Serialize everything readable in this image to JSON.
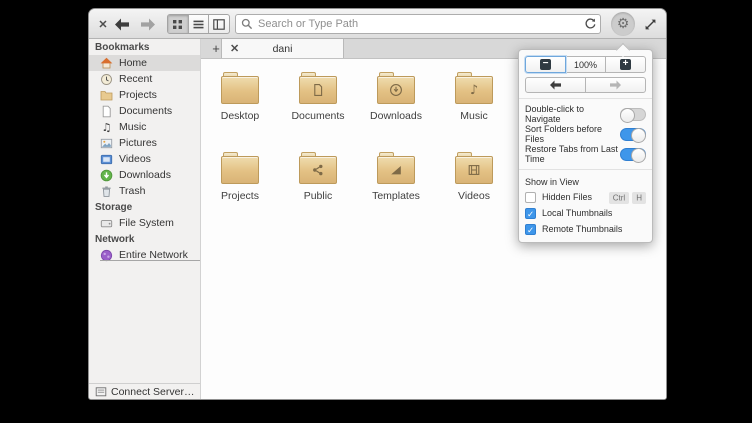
{
  "toolbar": {
    "close_glyph": "✕",
    "search_placeholder": "Search or Type Path"
  },
  "tabbar": {
    "new_tab_glyph": "+",
    "tab_close_glyph": "✕",
    "tab_title": "dani"
  },
  "sidebar": {
    "sections": [
      {
        "header": "Bookmarks",
        "items": [
          {
            "label": "Home"
          },
          {
            "label": "Recent"
          },
          {
            "label": "Projects"
          },
          {
            "label": "Documents"
          },
          {
            "label": "Music"
          },
          {
            "label": "Pictures"
          },
          {
            "label": "Videos"
          },
          {
            "label": "Downloads"
          },
          {
            "label": "Trash"
          }
        ]
      },
      {
        "header": "Storage",
        "items": [
          {
            "label": "File System"
          }
        ]
      },
      {
        "header": "Network",
        "items": [
          {
            "label": "Entire Network"
          }
        ]
      }
    ],
    "connect_server_label": "Connect Server…"
  },
  "files": [
    {
      "name": "Desktop"
    },
    {
      "name": "Documents"
    },
    {
      "name": "Downloads"
    },
    {
      "name": "Music"
    },
    {
      "name": "Projects"
    },
    {
      "name": "Public"
    },
    {
      "name": "Templates"
    },
    {
      "name": "Videos"
    }
  ],
  "popover": {
    "zoom_out_glyph": "−",
    "zoom_level": "100%",
    "zoom_in_glyph": "+",
    "toggles": [
      {
        "label": "Double-click to Navigate",
        "on": false
      },
      {
        "label": "Sort Folders before Files",
        "on": true
      },
      {
        "label": "Restore Tabs from Last Time",
        "on": true
      }
    ],
    "show_in_view_label": "Show in View",
    "checkboxes": [
      {
        "label": "Hidden Files",
        "checked": false,
        "shortcut": [
          "Ctrl",
          "H"
        ]
      },
      {
        "label": "Local Thumbnails",
        "checked": true
      },
      {
        "label": "Remote Thumbnails",
        "checked": true
      }
    ]
  },
  "colors": {
    "accent": "#3e96ea",
    "folder": "#e3c184",
    "selection": "#dcdbda"
  }
}
